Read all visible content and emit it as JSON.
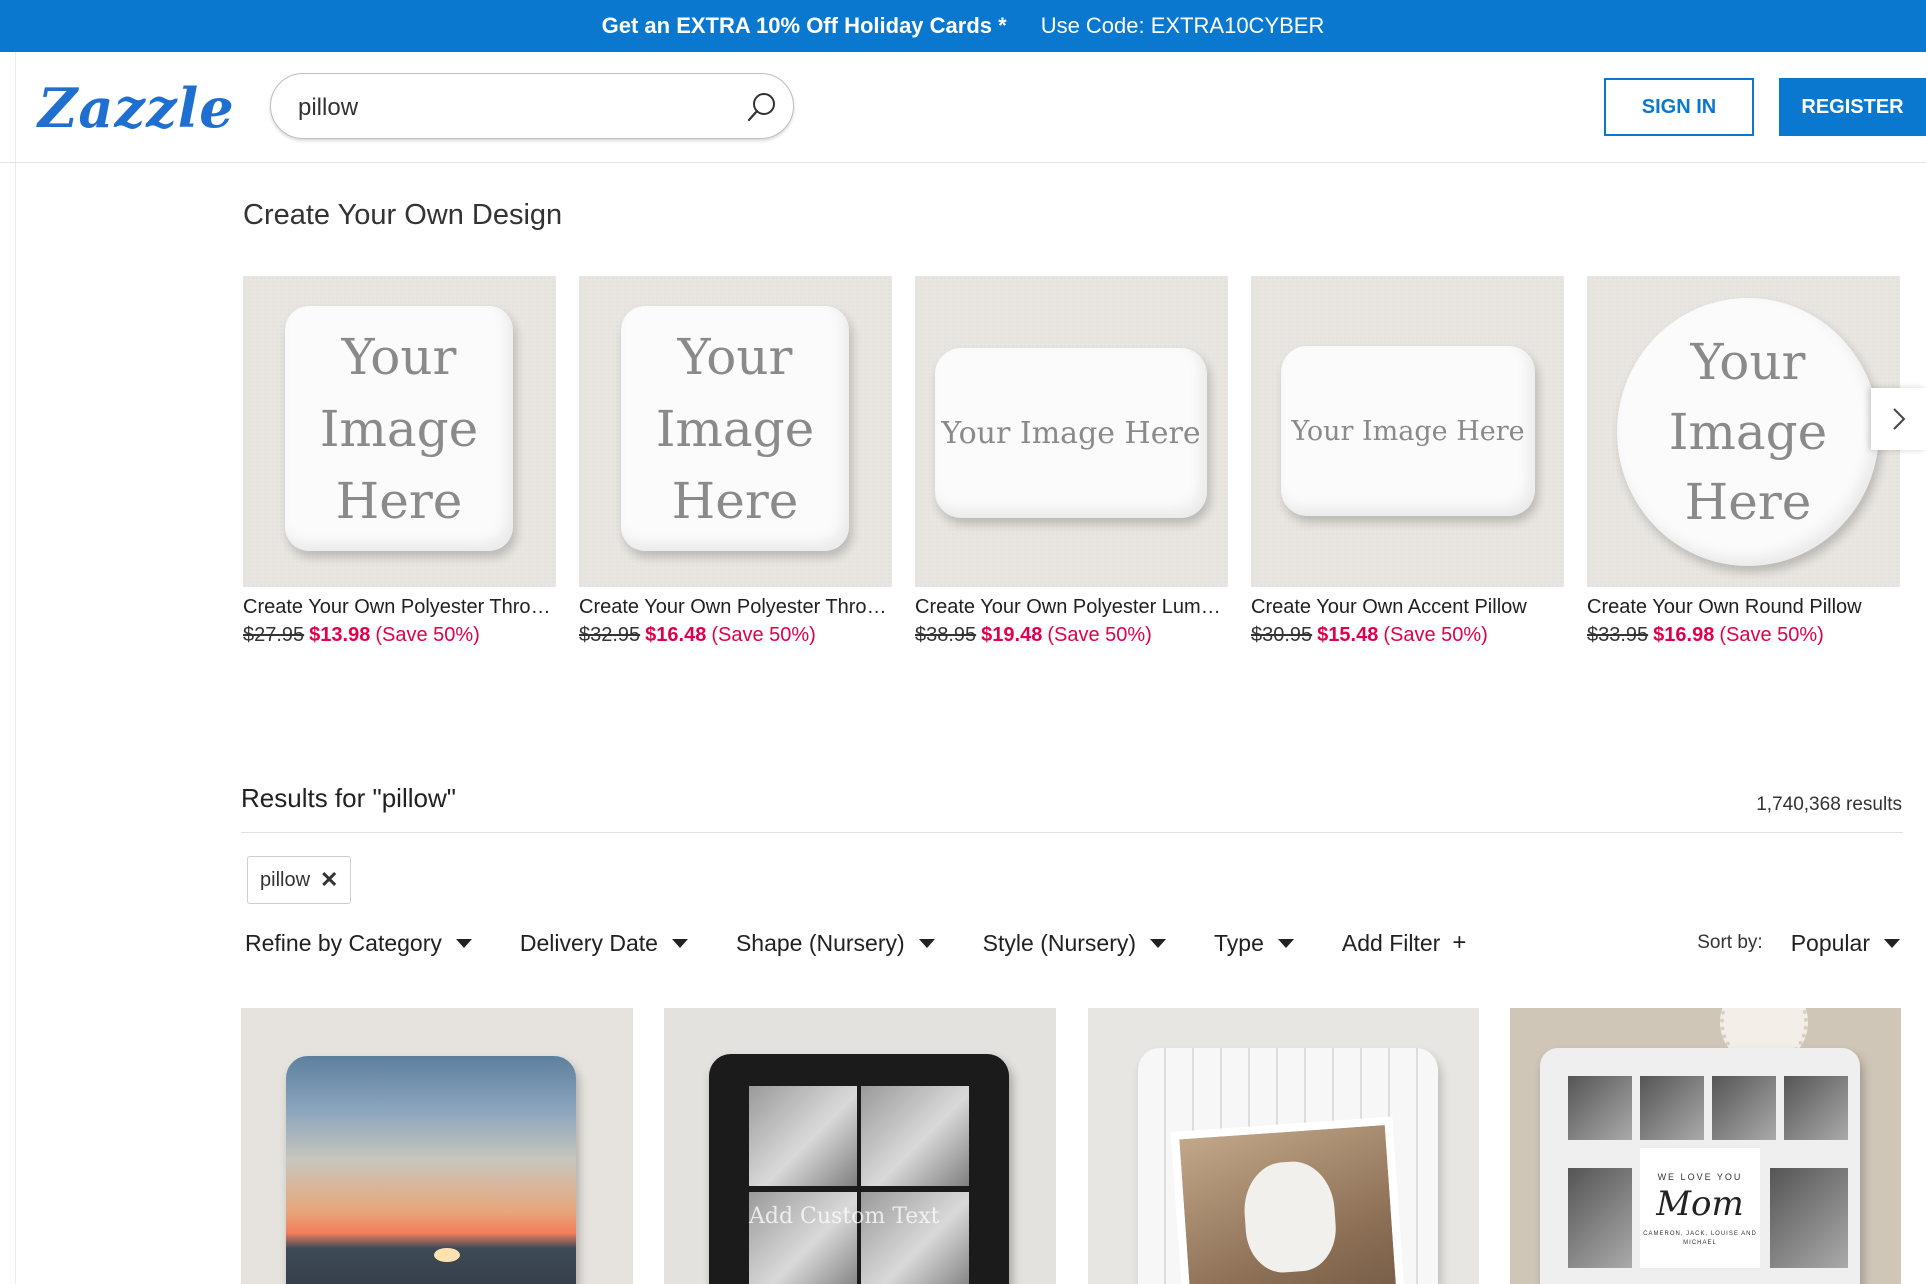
{
  "promo": {
    "headline": "Get an EXTRA 10% Off Holiday Cards *",
    "code": "Use Code: EXTRA10CYBER"
  },
  "header": {
    "logo": "Zazzle",
    "search_value": "pillow",
    "search_icon": "search-icon",
    "sign_in": "SIGN IN",
    "register": "REGISTER"
  },
  "colors": {
    "brand_blue": "#0b78d0",
    "sale_red": "#e0004d"
  },
  "create_own": {
    "title": "Create Your Own Design",
    "placeholder_text": "Your Image Here",
    "items": [
      {
        "name": "Create Your Own Polyester Throw Pillow",
        "original_price": "$27.95",
        "sale_price": "$13.98",
        "save": "(Save 50%)"
      },
      {
        "name": "Create Your Own Polyester Throw Pillow",
        "original_price": "$32.95",
        "sale_price": "$16.48",
        "save": "(Save 50%)"
      },
      {
        "name": "Create Your Own Polyester Lumbar Pillow",
        "original_price": "$38.95",
        "sale_price": "$19.48",
        "save": "(Save 50%)"
      },
      {
        "name": "Create Your Own Accent Pillow",
        "original_price": "$30.95",
        "sale_price": "$15.48",
        "save": "(Save 50%)"
      },
      {
        "name": "Create Your Own Round Pillow",
        "original_price": "$33.95",
        "sale_price": "$16.98",
        "save": "(Save 50%)"
      }
    ],
    "next_icon": "chevron-right-icon"
  },
  "results": {
    "title": "Results for \"pillow\"",
    "count": "1,740,368 results",
    "chip": {
      "label": "pillow",
      "close": "✕"
    },
    "filters": [
      {
        "label": "Refine by Category"
      },
      {
        "label": "Delivery Date"
      },
      {
        "label": "Shape (Nursery)"
      },
      {
        "label": "Style (Nursery)"
      },
      {
        "label": "Type"
      }
    ],
    "add_filter": "Add Filter",
    "add_filter_icon": "+",
    "sort_label": "Sort by:",
    "sort_value": "Popular",
    "tile_texts": {
      "custom_text": "Add Custom Text",
      "we_love_you": "WE LOVE YOU",
      "mom": "Mom",
      "names": "CAMERON, JACK, LOUISE AND MICHAEL"
    }
  }
}
